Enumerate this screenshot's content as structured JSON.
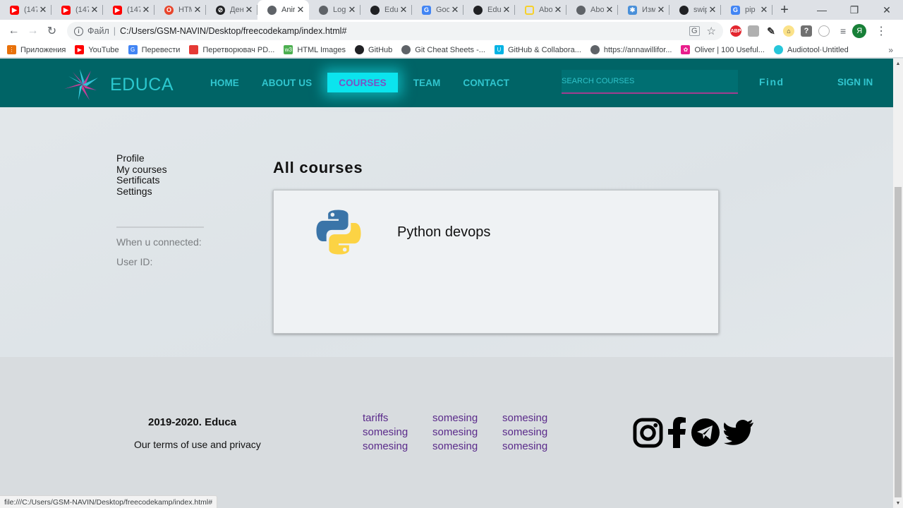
{
  "browser": {
    "tabs": [
      {
        "title": "(147",
        "icon": "youtube-icon",
        "color": "#ff0000"
      },
      {
        "title": "(147",
        "icon": "youtube-icon",
        "color": "#ff0000"
      },
      {
        "title": "(147",
        "icon": "youtube-icon",
        "color": "#ff0000"
      },
      {
        "title": "HTM",
        "icon": "opera-icon",
        "color": "#e8452c"
      },
      {
        "title": "Ден",
        "icon": "link-icon",
        "color": "#202124"
      },
      {
        "title": "Anir",
        "icon": "globe-icon",
        "color": "#5f6368",
        "active": true
      },
      {
        "title": "Log",
        "icon": "globe-icon",
        "color": "#5f6368"
      },
      {
        "title": "Edu",
        "icon": "github-icon",
        "color": "#202124"
      },
      {
        "title": "Goo",
        "icon": "google-translate-icon",
        "color": "#4285f4"
      },
      {
        "title": "Edu",
        "icon": "github-icon",
        "color": "#202124"
      },
      {
        "title": "Abo",
        "icon": "national-geographic-icon",
        "color": "#f6d12b"
      },
      {
        "title": "Abo",
        "icon": "globe-icon",
        "color": "#5f6368"
      },
      {
        "title": "Изм",
        "icon": "extension-icon",
        "color": "#4a90d9"
      },
      {
        "title": "swip",
        "icon": "github-icon",
        "color": "#202124"
      },
      {
        "title": "pip",
        "icon": "google-icon",
        "color": "#4285f4"
      }
    ],
    "tab_close": "✕",
    "new_tab": "+",
    "window": {
      "minimize": "—",
      "maximize": "❐",
      "close": "✕"
    },
    "nav": {
      "back": "←",
      "forward": "→",
      "reload": "↻"
    },
    "address": {
      "scheme_label": "Файл",
      "url": "C:/Users/GSM-NAVIN/Desktop/freecodekamp/index.html#"
    },
    "profile_initial": "Я",
    "bookmarks": [
      {
        "label": "Приложения",
        "icon": "apps-icon",
        "color": "#e8710a"
      },
      {
        "label": "YouTube",
        "icon": "youtube-icon",
        "color": "#ff0000"
      },
      {
        "label": "Перевести",
        "icon": "google-translate-icon",
        "color": "#4285f4"
      },
      {
        "label": "Перетворювач PD...",
        "icon": "pdf-converter-icon",
        "color": "#e53935"
      },
      {
        "label": "HTML Images",
        "icon": "w3schools-icon",
        "color": "#4caf50"
      },
      {
        "label": "GitHub",
        "icon": "github-icon",
        "color": "#202124"
      },
      {
        "label": "Git Cheat Sheets -...",
        "icon": "globe-icon",
        "color": "#5f6368"
      },
      {
        "label": "GitHub & Collabora...",
        "icon": "udacity-icon",
        "color": "#02b3e4"
      },
      {
        "label": "https://annawillifor...",
        "icon": "globe-icon",
        "color": "#5f6368"
      },
      {
        "label": "Oliver | 100 Useful...",
        "icon": "bookmark-site-icon",
        "color": "#e91e8c"
      },
      {
        "label": "Audiotool·Untitled",
        "icon": "audiotool-icon",
        "color": "#26c6da"
      }
    ],
    "bookmarks_more": "»",
    "status_url": "file:///C:/Users/GSM-NAVIN/Desktop/freecodekamp/index.html#"
  },
  "site": {
    "brand": "EDUCA",
    "nav": [
      {
        "label": "HOME"
      },
      {
        "label": "ABOUT US"
      },
      {
        "label": "COURSES",
        "active": true
      },
      {
        "label": "TEAM"
      },
      {
        "label": "CONTACT"
      }
    ],
    "search_placeholder": "SEARCH COURSES",
    "find_label": "Find",
    "signin_label": "SIGN IN",
    "colors": {
      "header": "#006466",
      "accent": "#0be4ee",
      "nav_text": "#31c6cf",
      "search_underline": "#a13d90"
    }
  },
  "sidebar": {
    "links": [
      "Profile",
      "My courses",
      "Sertificats",
      "Settings"
    ],
    "meta": [
      "When u connected:",
      "User ID:"
    ]
  },
  "main": {
    "title": "All courses",
    "courses": [
      {
        "name": "Python devops",
        "icon": "python-logo-icon"
      }
    ]
  },
  "footer": {
    "copyright": "2019-2020. Educa",
    "terms": "Our terms of use and privacy",
    "links": [
      "tariffs",
      "somesing",
      "somesing",
      "somesing",
      "somesing",
      "somesing",
      "somesing",
      "somesing",
      "somesing"
    ],
    "social": [
      "instagram-icon",
      "facebook-icon",
      "telegram-icon",
      "twitter-icon"
    ]
  }
}
